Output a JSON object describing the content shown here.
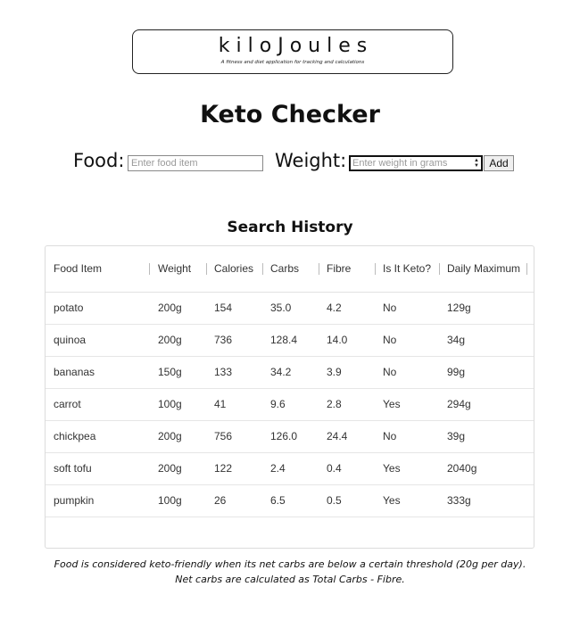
{
  "logo": {
    "title": "kiloJoules",
    "tagline": "A fitness and diet application for tracking and calculations"
  },
  "page_title": "Keto Checker",
  "form": {
    "food_label": "Food:",
    "food_placeholder": "Enter food item",
    "weight_label": "Weight:",
    "weight_placeholder": "Enter weight in grams",
    "add_label": "Add"
  },
  "history": {
    "title": "Search History",
    "columns": [
      "Food Item",
      "Weight",
      "Calories",
      "Carbs",
      "Fibre",
      "Is It Keto?",
      "Daily Maximum"
    ],
    "rows": [
      [
        "potato",
        "200g",
        "154",
        "35.0",
        "4.2",
        "No",
        "129g"
      ],
      [
        "quinoa",
        "200g",
        "736",
        "128.4",
        "14.0",
        "No",
        "34g"
      ],
      [
        "bananas",
        "150g",
        "133",
        "34.2",
        "3.9",
        "No",
        "99g"
      ],
      [
        "carrot",
        "100g",
        "41",
        "9.6",
        "2.8",
        "Yes",
        "294g"
      ],
      [
        "chickpea",
        "200g",
        "756",
        "126.0",
        "24.4",
        "No",
        "39g"
      ],
      [
        "soft tofu",
        "200g",
        "122",
        "2.4",
        "0.4",
        "Yes",
        "2040g"
      ],
      [
        "pumpkin",
        "100g",
        "26",
        "6.5",
        "0.5",
        "Yes",
        "333g"
      ]
    ]
  },
  "footnote": {
    "line1": "Food is considered keto-friendly when its net carbs are below a certain threshold (20g per day).",
    "line2": "Net carbs are calculated as Total Carbs - Fibre."
  }
}
